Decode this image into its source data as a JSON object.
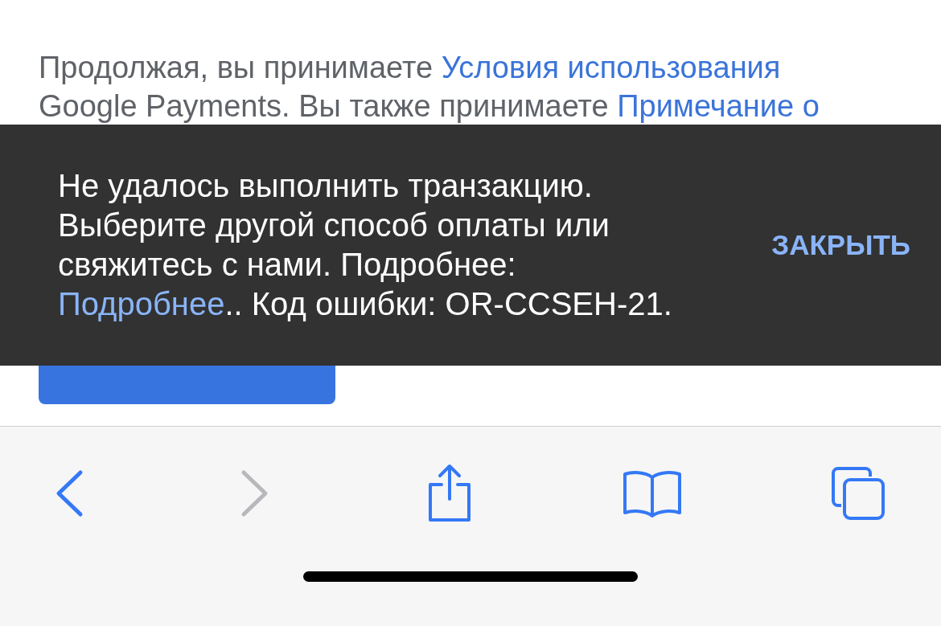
{
  "terms": [
    {
      "kind": "plain",
      "text": "Продолжая, вы принимаете "
    },
    {
      "kind": "link",
      "text": "Условия использования"
    },
    {
      "kind": "plain",
      "text": " Google Payments. Вы также принимаете "
    },
    {
      "kind": "link",
      "text": "Примечание о"
    }
  ],
  "snackbar": {
    "message": [
      {
        "kind": "plain",
        "text": "Не удалось выполнить транзакцию. Выберите другой способ оплаты или свяжитесь с нами. Подробнее: "
      },
      {
        "kind": "link",
        "text": "Подробнее"
      },
      {
        "kind": "plain",
        "text": ".. Код ошибки: OR-CCSEH-21."
      }
    ],
    "action": "ЗАКРЫТЬ"
  },
  "toolbar": {
    "back_disabled": false,
    "forward_disabled": true
  }
}
